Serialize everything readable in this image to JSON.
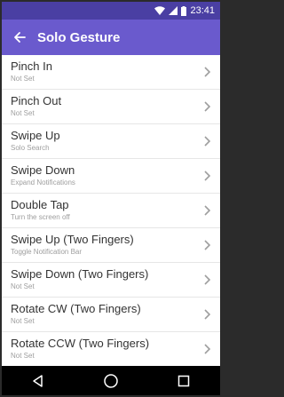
{
  "status": {
    "time": "23:41",
    "icons": [
      "wifi-icon",
      "signal-icon",
      "battery-icon"
    ]
  },
  "appbar": {
    "title": "Solo Gesture",
    "back_icon": "arrow-left-icon"
  },
  "items": [
    {
      "title": "Pinch In",
      "subtitle": "Not Set"
    },
    {
      "title": "Pinch Out",
      "subtitle": "Not Set"
    },
    {
      "title": "Swipe Up",
      "subtitle": "Solo Search"
    },
    {
      "title": "Swipe Down",
      "subtitle": "Expand Notifications"
    },
    {
      "title": "Double Tap",
      "subtitle": "Turn the screen off"
    },
    {
      "title": "Swipe Up (Two Fingers)",
      "subtitle": "Toggle Notification Bar"
    },
    {
      "title": "Swipe Down (Two Fingers)",
      "subtitle": "Not Set"
    },
    {
      "title": "Rotate CW (Two Fingers)",
      "subtitle": "Not Set"
    },
    {
      "title": "Rotate CCW (Two Fingers)",
      "subtitle": "Not Set"
    }
  ],
  "navbar": {
    "buttons": [
      "back-triangle-icon",
      "home-circle-icon",
      "recents-square-icon"
    ]
  },
  "colors": {
    "statusbar": "#4a3fa3",
    "appbar": "#6a5acd",
    "text_primary": "#333333",
    "text_secondary": "#9e9e9e",
    "chevron": "#9e9e9e"
  }
}
